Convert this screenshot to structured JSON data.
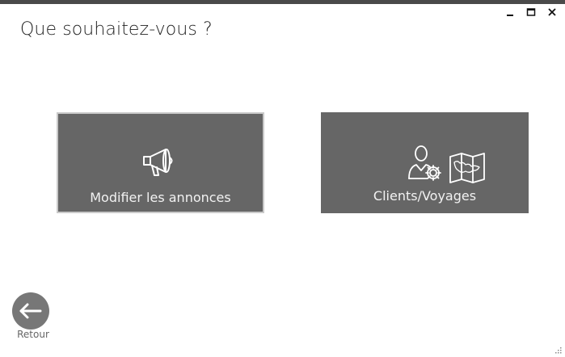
{
  "window": {
    "minimize_icon": "minimize-icon",
    "maximize_icon": "maximize-icon",
    "close_icon": "close-icon"
  },
  "page": {
    "title": "Que souhaitez-vous ?"
  },
  "tiles": [
    {
      "label": "Modifier les annonces",
      "icon": "megaphone-icon"
    },
    {
      "label": "Clients/Voyages",
      "icon": "user-settings-map-icon"
    }
  ],
  "back": {
    "label": "Retour",
    "icon": "arrow-left-icon"
  },
  "colors": {
    "tile_bg": "#666666",
    "tile_border_selected": "#c9c9c9",
    "back_bg": "#777777",
    "top_strip": "#4a4a4a"
  }
}
